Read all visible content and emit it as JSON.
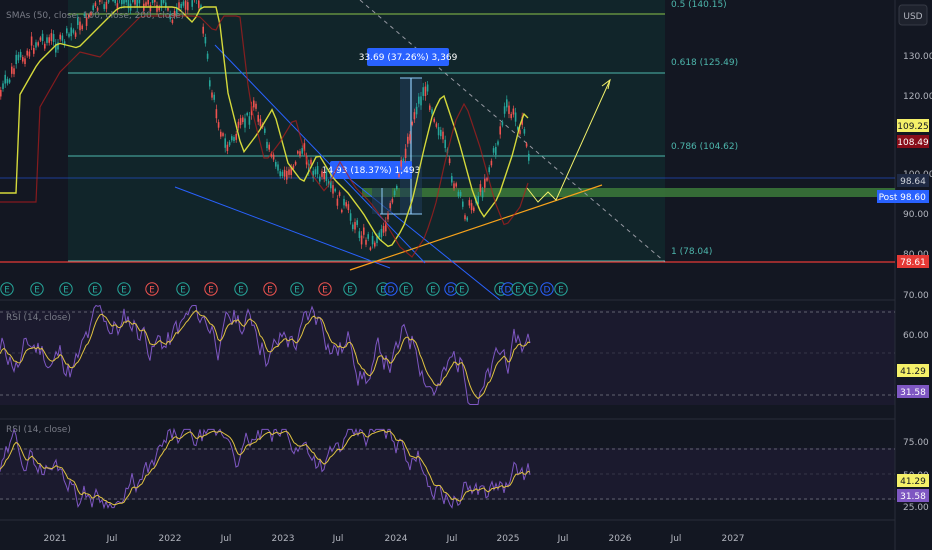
{
  "currency_button": "USD",
  "panes": {
    "main_title": "SMAs (50, close, 100, close, 200, close)",
    "rsi1_title": "RSI (14, close)",
    "rsi2_title": "RSI (14, close)"
  },
  "price_axis": {
    "ticks": [
      "130.00",
      "120.00",
      "110.00",
      "100.00",
      "90.00",
      "80.00",
      "70.00"
    ],
    "badges": {
      "sma_yellow": "109.25",
      "sma_red": "108.49",
      "price": "98.64",
      "post_label": "Post",
      "post_price": "98.60",
      "low_line": "78.61"
    }
  },
  "rsi1_axis": {
    "ticks": [
      "60.00"
    ],
    "badges": [
      "41.29",
      "31.58"
    ]
  },
  "rsi2_axis": {
    "ticks": [
      "75.00",
      "50.00",
      "25.00"
    ],
    "badges": [
      "41.29",
      "31.58"
    ]
  },
  "time_axis": [
    "2021",
    "Jul",
    "2022",
    "Jul",
    "2023",
    "Jul",
    "2024",
    "Jul",
    "2025",
    "Jul",
    "2026",
    "Jul",
    "2027"
  ],
  "fib_levels": [
    {
      "text": "0.5 (140.15)"
    },
    {
      "text": "0.618 (125.49)"
    },
    {
      "text": "0.786 (104.62)"
    },
    {
      "text": "1 (78.04)"
    }
  ],
  "measure_labels": {
    "big": "33.69 (37.26%) 3,369",
    "small": "14.93 (18.37%) 1,493"
  },
  "event_markers": [
    "E",
    "E",
    "E",
    "E",
    "E",
    "E",
    "E",
    "E",
    "E",
    "E",
    "E",
    "E",
    "E",
    "E",
    "D",
    "E",
    "E",
    "D",
    "E",
    "E",
    "D",
    "E",
    "E",
    "D",
    "E"
  ],
  "colors": {
    "bg": "#131722",
    "grid": "#1e222d",
    "fib_teal": "#4db6ac",
    "sma_yellow": "#d4d93b",
    "sma_red": "#b71c1c",
    "trend_blue": "#2962ff",
    "trend_orange": "#f7a21b",
    "rsi_purple": "#7e57c2",
    "rsi_ma_yellow": "#e0c341",
    "zone_green": "#3c7a3a"
  }
}
